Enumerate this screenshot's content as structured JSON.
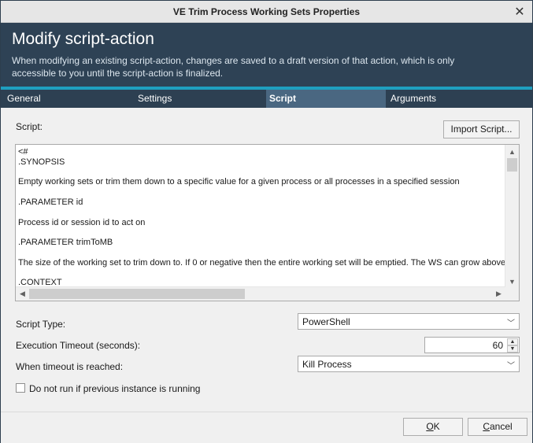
{
  "window": {
    "title": "VE Trim Process Working Sets Properties"
  },
  "header": {
    "title": "Modify script-action",
    "description": "When modifying an existing script-action, changes are saved to a draft version of that action, which is only accessible to you until the script-action is finalized."
  },
  "tabs": [
    "General",
    "Settings",
    "Script",
    "Arguments"
  ],
  "active_tab": "Script",
  "script": {
    "label": "Script:",
    "import_button": "Import Script...",
    "lines": [
      "<#",
      ".SYNOPSIS",
      "",
      "Empty working sets or trim them down to a specific value for a given process or all processes in a specified session",
      "",
      ".PARAMETER id",
      "",
      "Process id or session id to act on",
      "",
      ".PARAMETER trimToMB",
      "",
      "The size of the working set to trim down to. If 0 or negative then the entire working set will be emptied. The WS can grow above this",
      "",
      ".CONTEXT"
    ]
  },
  "script_type": {
    "label": "Script Type:",
    "value": "PowerShell"
  },
  "execution_timeout": {
    "label": "Execution Timeout (seconds):",
    "value": "60"
  },
  "timeout_action": {
    "label": "When timeout is reached:",
    "value": "Kill Process"
  },
  "do_not_run": {
    "label": "Do not run if previous instance is running",
    "checked": false
  },
  "footer": {
    "ok_label": "OK",
    "cancel_label": "Cancel"
  },
  "colors": {
    "header_bg": "#2e4255",
    "accent": "#1f9fbf",
    "tab_bg": "#2d4052",
    "tab_active_bg": "#4a6781"
  },
  "icons": [
    "close-icon",
    "scroll-up-icon",
    "scroll-down-icon",
    "scroll-left-icon",
    "scroll-right-icon",
    "chevron-down-icon",
    "spin-up-icon",
    "spin-down-icon"
  ]
}
